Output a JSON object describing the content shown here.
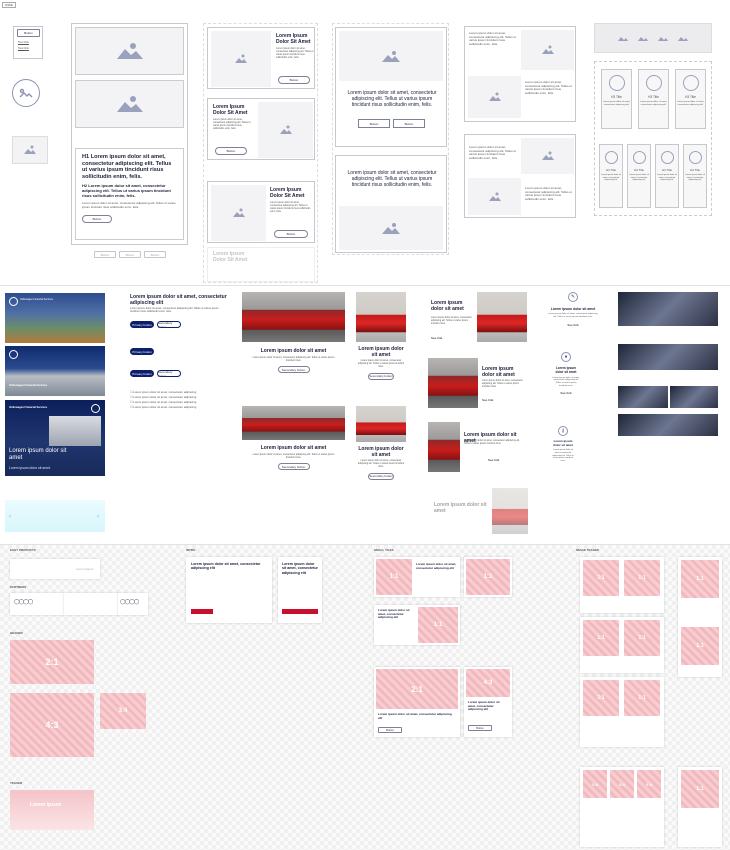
{
  "top_tag": "WIRE",
  "menu": {
    "items": [
      "Button",
      "Text link",
      "Text link"
    ]
  },
  "hero_wire": {
    "h1": "H1 Lorem ipsum dolor sit amet, consectetur adipiscing elit. Tellus ut varius ipsum tincidunt risus sollicitudin enim, felis.",
    "h2": "H2 Lorem ipsum dolor sit amet, consectetur adipiscing elit. Tellus ut varius ipsum tincidunt risus sollicitudin enim, felis.",
    "body": "Lorem ipsum dolor sit amet, consectetur adipiscing elit. Tellus ut varius ipsum tincidunt risus sollicitudin enim, felis.",
    "button": "Button"
  },
  "tabs_wire": [
    "Button",
    "Button",
    "Button"
  ],
  "col3": {
    "title": "Lorem Ipsum Dolor Sit Amet",
    "text": "Lorem ipsum dolor sit amet, consectetur adipiscing elit. Tellus ut varius ipsum tincidunt risus sollicitudin enim, felis.",
    "button": "Button"
  },
  "col4": {
    "text": "Lorem ipsum dolor sit amet, consectetur adipiscing elit. Tellus ut varius ipsum tincidunt risus sollicitudin enim, felis.",
    "button_a": "Button",
    "button_b": "Button"
  },
  "col5": {
    "text": "Lorem ipsum dolor sit amet, consectetur adipiscing elit. Tellus ut varius ipsum tincidunt risus sollicitudin enim, felis."
  },
  "icon_tiles": {
    "title": "H3 Title",
    "text": "Lorem ipsum dolor sit amet, consectetur adipiscing elit."
  },
  "vw": {
    "brand_line": "Volkswagen Financial Services",
    "banner_title": "Lorem ipsum dolor sit amet",
    "banner_sub": "Lorem ipsum dolor sit amet.",
    "headline": "Lorem ipsum dolor sit amet, consectetur adipiscing elit",
    "body": "Lorem ipsum dolor sit amet, consectetur adipiscing elit. Tellus ut varius ipsum tincidunt risus sollicitudin enim, felis.",
    "primary": "Primary button",
    "secondary": "Secondary button",
    "checklist": [
      "Lorem ipsum dolor sit amet, consectetur adipiscing",
      "Lorem ipsum dolor sit amet, consectetur adipiscing",
      "Lorem ipsum dolor sit amet, consectetur adipiscing",
      "Lorem ipsum dolor sit amet, consectetur adipiscing"
    ],
    "card_title": "Lorem ipsum dolor sit amet",
    "card_text": "Lorem ipsum dolor sit amet, consectetur adipiscing elit. Tellus ut varius ipsum tincidunt risus.",
    "card_button": "Secondary button",
    "see_link": "See link"
  },
  "bottom": {
    "sec1": "EASY PRODUCTS",
    "sec2": "INTRO",
    "sec3": "PARTNERS",
    "sec4": "HEADER",
    "sec5": "SMALL TILES",
    "sec6": "TEASER",
    "sec7": "IMAGE TEASER",
    "sec8": "LARGE TEASER",
    "label": "Lorem ipsum",
    "ratio_21": "2:1",
    "ratio_43": "4:3",
    "ratio_11": "1:1",
    "ratio_34": "3:4",
    "teaser_title": "Lorem ipsum dolor sit amet, consectetur adipiscing elit",
    "teaser_btn": "Button"
  }
}
